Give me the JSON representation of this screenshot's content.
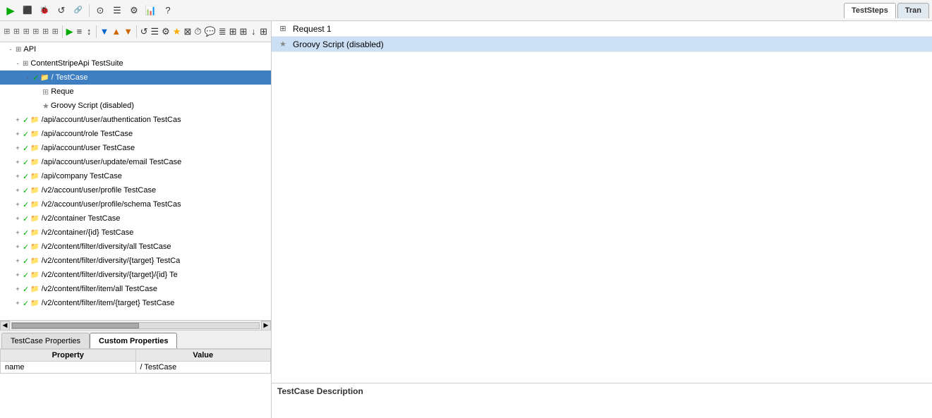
{
  "topToolbar": {
    "runLabel": "▶",
    "tabs": [
      {
        "id": "testSteps",
        "label": "TestSteps",
        "active": true
      },
      {
        "id": "tran",
        "label": "Tran",
        "active": false
      }
    ],
    "icons": [
      "▶",
      "⬛",
      "⬛",
      "↺",
      "⬛",
      "🔗",
      "⊙",
      "☰",
      "⚙",
      "📊",
      "?"
    ]
  },
  "leftToolbar": {
    "icons": [
      "⊞",
      "⊞",
      "⊞",
      "⊞",
      "⊞",
      "⊞",
      "▶",
      "≡",
      "↕",
      "▼",
      "▲",
      "▼",
      "↺",
      "☰",
      "⚙",
      "★",
      "⊠",
      "⏱",
      "💬",
      "≣",
      "⊞",
      "⊞",
      "↓",
      "⊞"
    ]
  },
  "tree": {
    "rootLabel": "API",
    "suiteLabel": "ContentStripeApi TestSuite",
    "items": [
      {
        "id": "testcase-root",
        "label": "/ TestCase",
        "indent": 2,
        "selected": true,
        "hasCheck": true,
        "checkColor": "green",
        "expanded": true,
        "expandChar": "-"
      },
      {
        "id": "request1",
        "label": "Reque",
        "indent": 3,
        "isRequest": true,
        "selected": false
      },
      {
        "id": "groovy-disabled",
        "label": "Groovy Script (disabled)",
        "indent": 3,
        "isStar": true,
        "selected": false
      },
      {
        "id": "tc-auth",
        "label": "/api/account/user/authentication TestCas",
        "indent": 1,
        "hasCheck": true,
        "checkColor": "green",
        "hasExpander": true
      },
      {
        "id": "tc-role",
        "label": "/api/account/role TestCase",
        "indent": 1,
        "hasCheck": true,
        "checkColor": "green",
        "hasExpander": true
      },
      {
        "id": "tc-user",
        "label": "/api/account/user TestCase",
        "indent": 1,
        "hasCheck": true,
        "checkColor": "green",
        "hasExpander": true
      },
      {
        "id": "tc-email",
        "label": "/api/account/user/update/email TestCase",
        "indent": 1,
        "hasCheck": true,
        "checkColor": "green",
        "hasExpander": true
      },
      {
        "id": "tc-company",
        "label": "/api/company TestCase",
        "indent": 1,
        "hasCheck": true,
        "checkColor": "green",
        "hasExpander": true
      },
      {
        "id": "tc-v2profile",
        "label": "/v2/account/user/profile TestCase",
        "indent": 1,
        "hasCheck": true,
        "checkColor": "green",
        "hasExpander": true
      },
      {
        "id": "tc-v2schema",
        "label": "/v2/account/user/profile/schema TestCas",
        "indent": 1,
        "hasCheck": true,
        "checkColor": "green",
        "hasExpander": true
      },
      {
        "id": "tc-container",
        "label": "/v2/container TestCase",
        "indent": 1,
        "hasCheck": true,
        "checkColor": "green",
        "hasExpander": true
      },
      {
        "id": "tc-containerid",
        "label": "/v2/container/{id} TestCase",
        "indent": 1,
        "hasCheck": true,
        "checkColor": "green",
        "hasExpander": true
      },
      {
        "id": "tc-diversity-all",
        "label": "/v2/content/filter/diversity/all TestCase",
        "indent": 1,
        "hasCheck": true,
        "checkColor": "green",
        "hasExpander": true
      },
      {
        "id": "tc-diversity-target",
        "label": "/v2/content/filter/diversity/{target} TestCa",
        "indent": 1,
        "hasCheck": true,
        "checkColor": "green",
        "hasExpander": true
      },
      {
        "id": "tc-diversity-target-id",
        "label": "/v2/content/filter/diversity/{target}/{id} Te",
        "indent": 1,
        "hasCheck": true,
        "checkColor": "green",
        "hasExpander": true
      },
      {
        "id": "tc-item-all",
        "label": "/v2/content/filter/item/all TestCase",
        "indent": 1,
        "hasCheck": true,
        "checkColor": "green",
        "hasExpander": true
      },
      {
        "id": "tc-item-target",
        "label": "/v2/content/filter/item/{target} TestCase",
        "indent": 1,
        "hasCheck": true,
        "checkColor": "green",
        "hasExpander": true
      }
    ]
  },
  "bottomTabs": [
    {
      "id": "testcase-props",
      "label": "TestCase Properties",
      "active": false
    },
    {
      "id": "custom-props",
      "label": "Custom Properties",
      "active": true
    }
  ],
  "propertiesTable": {
    "headers": [
      "Property",
      "Value"
    ],
    "rows": [
      {
        "property": "name",
        "value": "/ TestCase"
      }
    ]
  },
  "rightPanel": {
    "tabs": [
      {
        "id": "testSteps",
        "label": "TestSteps",
        "active": true
      },
      {
        "id": "tran",
        "label": "Tran",
        "active": false
      }
    ],
    "steps": [
      {
        "id": "request1",
        "label": "Request 1",
        "icon": "⊞",
        "selected": false
      },
      {
        "id": "groovy-disabled",
        "label": "Groovy Script (disabled)",
        "icon": "★",
        "selected": true
      }
    ],
    "description": {
      "label": "TestCase Description"
    }
  }
}
